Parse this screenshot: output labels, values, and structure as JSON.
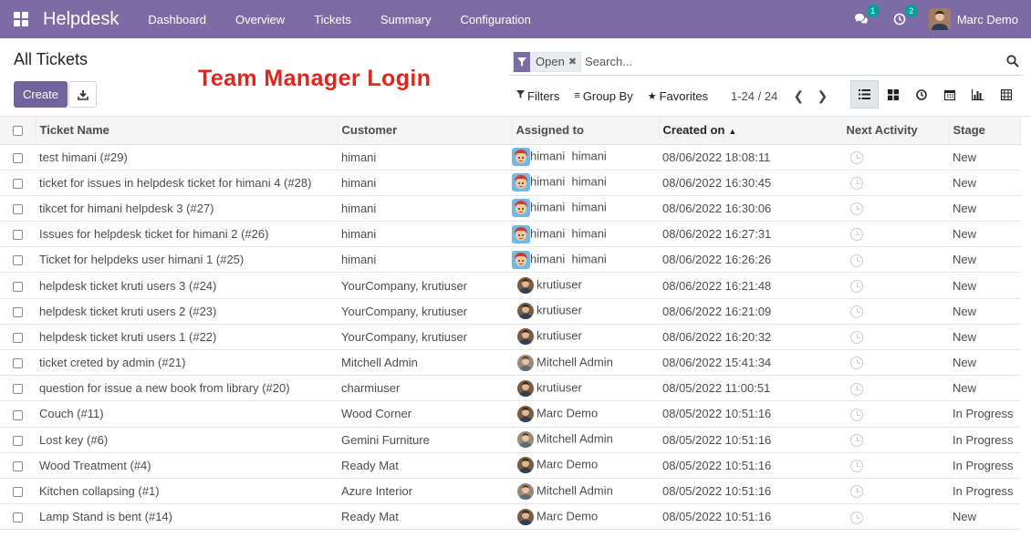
{
  "navbar": {
    "app_name": "Helpdesk",
    "menu": [
      "Dashboard",
      "Overview",
      "Tickets",
      "Summary",
      "Configuration"
    ],
    "messages_badge": "1",
    "activities_badge": "2",
    "user_name": "Marc Demo",
    "bg_color": "#7c6ba4"
  },
  "control_panel": {
    "breadcrumb": "All Tickets",
    "create_label": "Create",
    "overlay_caption": "Team Manager Login",
    "search": {
      "facet_value": "Open",
      "placeholder": "Search..."
    },
    "filters_label": "Filters",
    "group_by_label": "Group By",
    "favorites_label": "Favorites",
    "pager_value": "1-24 / 24",
    "views": [
      "list-icon",
      "kanban-icon",
      "activity-icon",
      "calendar-icon",
      "graph-icon",
      "pivot-icon"
    ]
  },
  "table": {
    "columns": [
      "Ticket Name",
      "Customer",
      "Assigned to",
      "Created on",
      "Next Activity",
      "Stage"
    ],
    "sort_column": "Created on",
    "rows": [
      {
        "name": "test himani (#29)",
        "customer": "himani",
        "assigned": "himani  himani",
        "created": "08/06/2022 18:08:11",
        "stage": "New",
        "avatar": "kid"
      },
      {
        "name": "ticket for issues in helpdesk ticket for himani 4 (#28)",
        "customer": "himani",
        "assigned": "himani  himani",
        "created": "08/06/2022 16:30:45",
        "stage": "New",
        "avatar": "kid"
      },
      {
        "name": "tikcet for himani helpdesk 3 (#27)",
        "customer": "himani",
        "assigned": "himani  himani",
        "created": "08/06/2022 16:30:06",
        "stage": "New",
        "avatar": "kid"
      },
      {
        "name": "Issues for helpdesk ticket for himani 2 (#26)",
        "customer": "himani",
        "assigned": "himani  himani",
        "created": "08/06/2022 16:27:31",
        "stage": "New",
        "avatar": "kid"
      },
      {
        "name": "Ticket for helpdeks user himani 1 (#25)",
        "customer": "himani",
        "assigned": "himani  himani",
        "created": "08/06/2022 16:26:26",
        "stage": "New",
        "avatar": "kid"
      },
      {
        "name": "helpdesk ticket kruti users 3 (#24)",
        "customer": "YourCompany, krutiuser",
        "assigned": "krutiuser",
        "created": "08/06/2022 16:21:48",
        "stage": "New",
        "avatar": "man"
      },
      {
        "name": "helpdesk ticket kruti users 2 (#23)",
        "customer": "YourCompany, krutiuser",
        "assigned": "krutiuser",
        "created": "08/06/2022 16:21:09",
        "stage": "New",
        "avatar": "man"
      },
      {
        "name": "helpdesk ticket kruti users 1 (#22)",
        "customer": "YourCompany, krutiuser",
        "assigned": "krutiuser",
        "created": "08/06/2022 16:20:32",
        "stage": "New",
        "avatar": "man"
      },
      {
        "name": "ticket creted by admin (#21)",
        "customer": "Mitchell Admin",
        "assigned": "Mitchell Admin",
        "created": "08/06/2022 15:41:34",
        "stage": "New",
        "avatar": "admin"
      },
      {
        "name": "question for issue a new book from library (#20)",
        "customer": "charmiuser",
        "assigned": "krutiuser",
        "created": "08/05/2022 11:00:51",
        "stage": "New",
        "avatar": "man"
      },
      {
        "name": "Couch (#11)",
        "customer": "Wood Corner",
        "assigned": "Marc Demo",
        "created": "08/05/2022 10:51:16",
        "stage": "In Progress",
        "avatar": "man"
      },
      {
        "name": "Lost key (#6)",
        "customer": "Gemini Furniture",
        "assigned": "Mitchell Admin",
        "created": "08/05/2022 10:51:16",
        "stage": "In Progress",
        "avatar": "admin"
      },
      {
        "name": "Wood Treatment (#4)",
        "customer": "Ready Mat",
        "assigned": "Marc Demo",
        "created": "08/05/2022 10:51:16",
        "stage": "In Progress",
        "avatar": "man"
      },
      {
        "name": "Kitchen collapsing (#1)",
        "customer": "Azure Interior",
        "assigned": "Mitchell Admin",
        "created": "08/05/2022 10:51:16",
        "stage": "In Progress",
        "avatar": "admin"
      },
      {
        "name": "Lamp Stand is bent (#14)",
        "customer": "Ready Mat",
        "assigned": "Marc Demo",
        "created": "08/05/2022 10:51:16",
        "stage": "New",
        "avatar": "man"
      }
    ]
  }
}
